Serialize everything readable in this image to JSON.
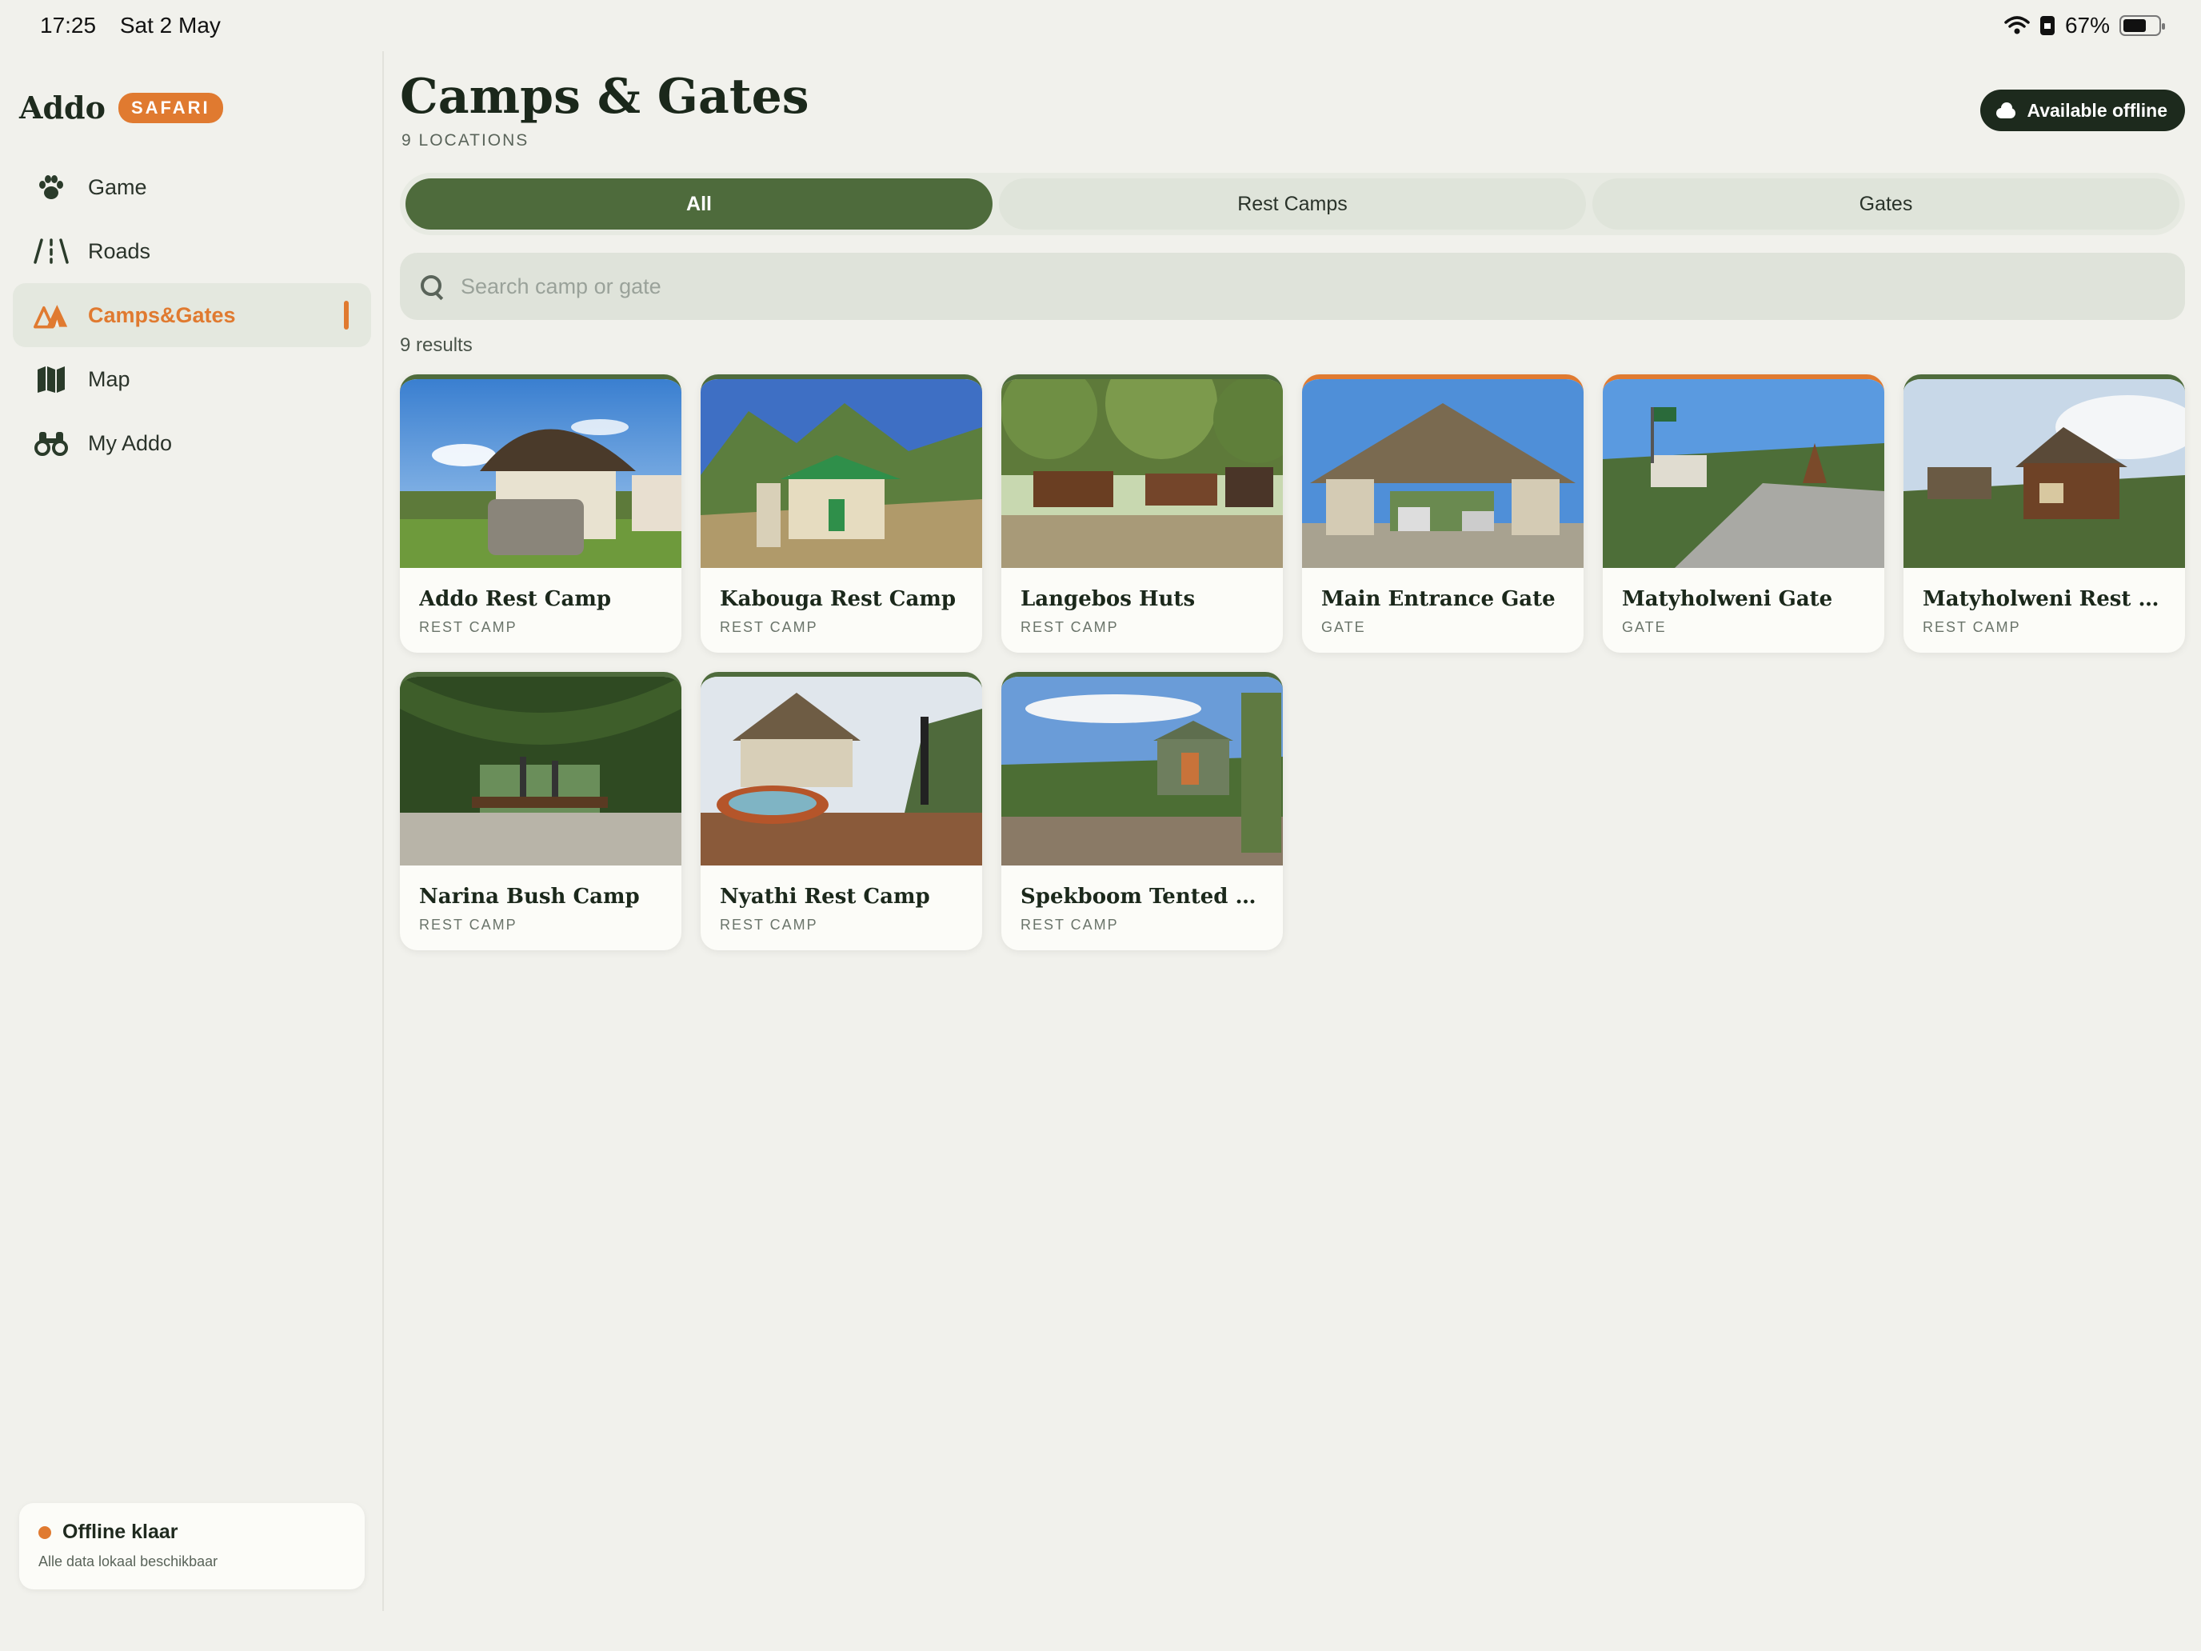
{
  "status": {
    "time": "17:25",
    "date": "Sat 2 May",
    "battery": "67%"
  },
  "sidebar": {
    "brand": "Addo",
    "badge": "SAFARI",
    "items": [
      {
        "label": "Game",
        "icon": "paw-icon"
      },
      {
        "label": "Roads",
        "icon": "road-icon"
      },
      {
        "label": "Camps&Gates",
        "icon": "tent-icon",
        "active": true
      },
      {
        "label": "Map",
        "icon": "map-icon"
      },
      {
        "label": "My Addo",
        "icon": "binoculars-icon"
      }
    ],
    "offline": {
      "title": "Offline klaar",
      "subtitle": "Alle data lokaal beschikbaar"
    }
  },
  "main": {
    "title": "Camps & Gates",
    "subtitle": "9 LOCATIONS",
    "offline_button": "Available offline",
    "tabs": [
      {
        "label": "All",
        "active": true
      },
      {
        "label": "Rest Camps"
      },
      {
        "label": "Gates"
      }
    ],
    "search": {
      "placeholder": "Search camp or gate",
      "value": ""
    },
    "results": "9 results",
    "cards": [
      {
        "name": "Addo Rest Camp",
        "type": "REST CAMP"
      },
      {
        "name": "Kabouga Rest Camp",
        "type": "REST CAMP"
      },
      {
        "name": "Langebos Huts",
        "type": "REST CAMP"
      },
      {
        "name": "Main Entrance Gate",
        "type": "GATE"
      },
      {
        "name": "Matyholweni Gate",
        "type": "GATE"
      },
      {
        "name": "Matyholweni Rest Ca...",
        "type": "REST CAMP"
      },
      {
        "name": "Narina Bush Camp",
        "type": "REST CAMP"
      },
      {
        "name": "Nyathi Rest Camp",
        "type": "REST CAMP"
      },
      {
        "name": "Spekboom Tented Res...",
        "type": "REST CAMP"
      }
    ]
  },
  "colors": {
    "accent": "#e07a30",
    "primary": "#4e6b3c",
    "dark": "#1d2a1d",
    "background": "#f1f1ec"
  }
}
